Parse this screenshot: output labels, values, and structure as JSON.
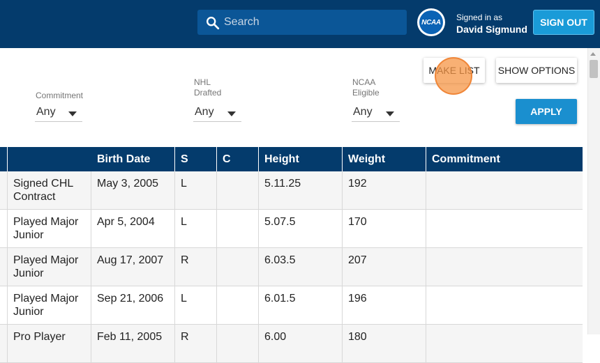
{
  "header": {
    "search_placeholder": "Search",
    "logo_text": "NCAA",
    "signed_in_label": "Signed in as",
    "user_name": "David Sigmund",
    "sign_out_label": "SIGN OUT"
  },
  "filters": {
    "commitment": {
      "label": "Commitment",
      "value": "Any"
    },
    "nhl_drafted": {
      "label_line1": "NHL",
      "label_line2": "Drafted",
      "value": "Any"
    },
    "ncaa_eligible": {
      "label_line1": "NCAA",
      "label_line2": "Eligible",
      "value": "Any"
    }
  },
  "actions": {
    "make_list": "MAKE LIST",
    "show_options": "SHOW OPTIONS",
    "apply": "APPLY"
  },
  "table": {
    "columns": [
      "Birth Date",
      "S",
      "C",
      "Height",
      "Weight",
      "Commitment"
    ],
    "rows": [
      {
        "status": "Signed CHL Contract",
        "birth_date": "May 3, 2005",
        "s": "L",
        "c": "",
        "height": "5.11.25",
        "weight": "192",
        "commitment": ""
      },
      {
        "status": "Played Major Junior",
        "birth_date": "Apr 5, 2004",
        "s": "L",
        "c": "",
        "height": "5.07.5",
        "weight": "170",
        "commitment": ""
      },
      {
        "status": "Played Major Junior",
        "birth_date": "Aug 17, 2007",
        "s": "R",
        "c": "",
        "height": "6.03.5",
        "weight": "207",
        "commitment": ""
      },
      {
        "status": "Played Major Junior",
        "birth_date": "Sep 21, 2006",
        "s": "L",
        "c": "",
        "height": "6.01.5",
        "weight": "196",
        "commitment": ""
      },
      {
        "status": "Pro Player",
        "birth_date": "Feb 11, 2005",
        "s": "R",
        "c": "",
        "height": "6.00",
        "weight": "180",
        "commitment": ""
      }
    ]
  },
  "colors": {
    "header_bg": "#043b6c",
    "search_bg": "#0b5697",
    "accent": "#1a9bd8"
  }
}
